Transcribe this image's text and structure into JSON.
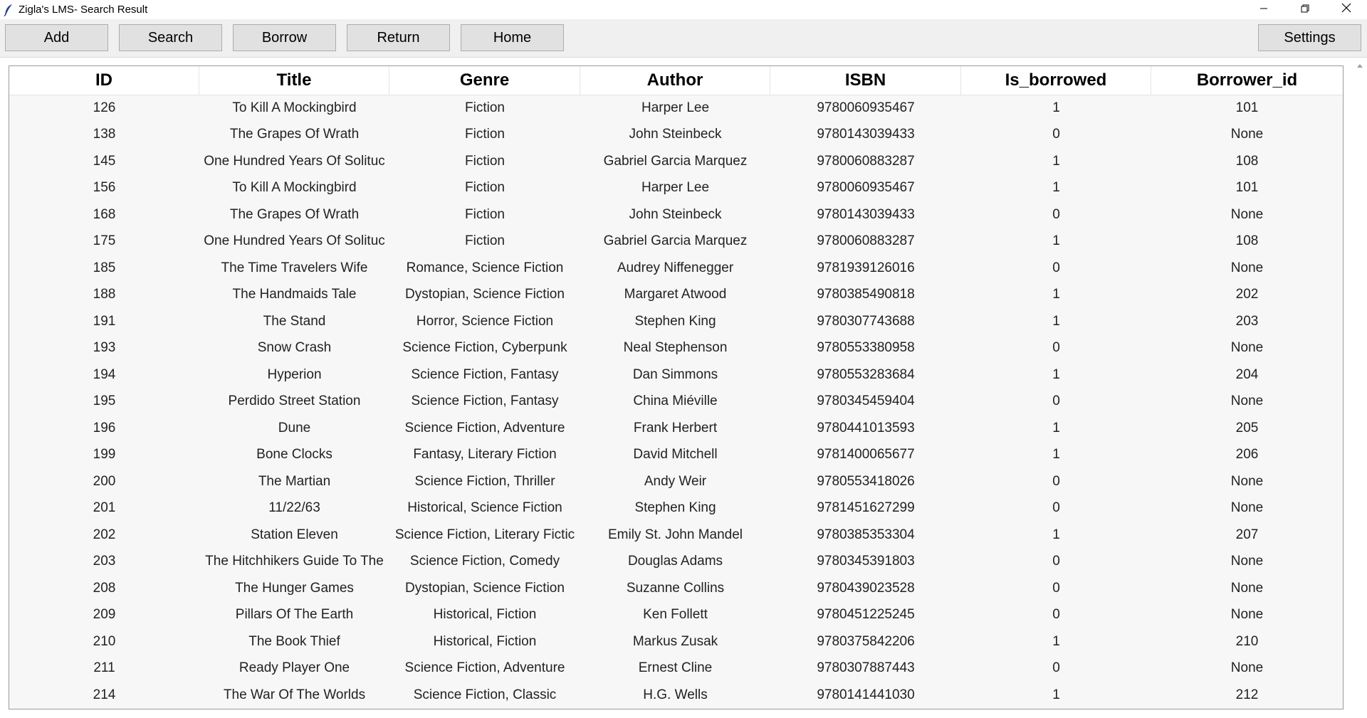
{
  "window": {
    "title": "Zigla's LMS- Search Result"
  },
  "toolbar": {
    "add_label": "Add",
    "search_label": "Search",
    "borrow_label": "Borrow",
    "return_label": "Return",
    "home_label": "Home",
    "settings_label": "Settings"
  },
  "table": {
    "columns": [
      "ID",
      "Title",
      "Genre",
      "Author",
      "ISBN",
      "Is_borrowed",
      "Borrower_id"
    ],
    "rows": [
      [
        "126",
        "To Kill A Mockingbird",
        "Fiction",
        "Harper Lee",
        "9780060935467",
        "1",
        "101"
      ],
      [
        "138",
        "The Grapes Of Wrath",
        "Fiction",
        "John Steinbeck",
        "9780143039433",
        "0",
        "None"
      ],
      [
        "145",
        "One Hundred Years Of Solituc",
        "Fiction",
        "Gabriel Garcia Marquez",
        "9780060883287",
        "1",
        "108"
      ],
      [
        "156",
        "To Kill A Mockingbird",
        "Fiction",
        "Harper Lee",
        "9780060935467",
        "1",
        "101"
      ],
      [
        "168",
        "The Grapes Of Wrath",
        "Fiction",
        "John Steinbeck",
        "9780143039433",
        "0",
        "None"
      ],
      [
        "175",
        "One Hundred Years Of Solituc",
        "Fiction",
        "Gabriel Garcia Marquez",
        "9780060883287",
        "1",
        "108"
      ],
      [
        "185",
        "The Time Travelers Wife",
        "Romance, Science Fiction",
        "Audrey Niffenegger",
        "9781939126016",
        "0",
        "None"
      ],
      [
        "188",
        "The Handmaids Tale",
        "Dystopian, Science Fiction",
        "Margaret Atwood",
        "9780385490818",
        "1",
        "202"
      ],
      [
        "191",
        "The Stand",
        "Horror, Science Fiction",
        "Stephen King",
        "9780307743688",
        "1",
        "203"
      ],
      [
        "193",
        "Snow Crash",
        "Science Fiction, Cyberpunk",
        "Neal Stephenson",
        "9780553380958",
        "0",
        "None"
      ],
      [
        "194",
        "Hyperion",
        "Science Fiction, Fantasy",
        "Dan Simmons",
        "9780553283684",
        "1",
        "204"
      ],
      [
        "195",
        "Perdido Street Station",
        "Science Fiction, Fantasy",
        "China Miéville",
        "9780345459404",
        "0",
        "None"
      ],
      [
        "196",
        "Dune",
        "Science Fiction, Adventure",
        "Frank Herbert",
        "9780441013593",
        "1",
        "205"
      ],
      [
        "199",
        "Bone Clocks",
        "Fantasy, Literary Fiction",
        "David Mitchell",
        "9781400065677",
        "1",
        "206"
      ],
      [
        "200",
        "The Martian",
        "Science Fiction, Thriller",
        "Andy Weir",
        "9780553418026",
        "0",
        "None"
      ],
      [
        "201",
        "11/22/63",
        "Historical, Science Fiction",
        "Stephen King",
        "9781451627299",
        "0",
        "None"
      ],
      [
        "202",
        "Station Eleven",
        "Science Fiction, Literary Fictic",
        "Emily St. John Mandel",
        "9780385353304",
        "1",
        "207"
      ],
      [
        "203",
        "The Hitchhikers Guide To The",
        "Science Fiction, Comedy",
        "Douglas Adams",
        "9780345391803",
        "0",
        "None"
      ],
      [
        "208",
        "The Hunger Games",
        "Dystopian, Science Fiction",
        "Suzanne Collins",
        "9780439023528",
        "0",
        "None"
      ],
      [
        "209",
        "Pillars Of The Earth",
        "Historical, Fiction",
        "Ken Follett",
        "9780451225245",
        "0",
        "None"
      ],
      [
        "210",
        "The Book Thief",
        "Historical, Fiction",
        "Markus Zusak",
        "9780375842206",
        "1",
        "210"
      ],
      [
        "211",
        "Ready Player One",
        "Science Fiction, Adventure",
        "Ernest Cline",
        "9780307887443",
        "0",
        "None"
      ],
      [
        "214",
        "The War Of The Worlds",
        "Science Fiction, Classic",
        "H.G. Wells",
        "9780141441030",
        "1",
        "212"
      ]
    ]
  },
  "icons": {
    "app": "feather-icon",
    "minimize": "minimize-icon",
    "maximize": "restore-icon",
    "close": "close-icon",
    "scroll_up": "scroll-up-arrow-icon"
  }
}
